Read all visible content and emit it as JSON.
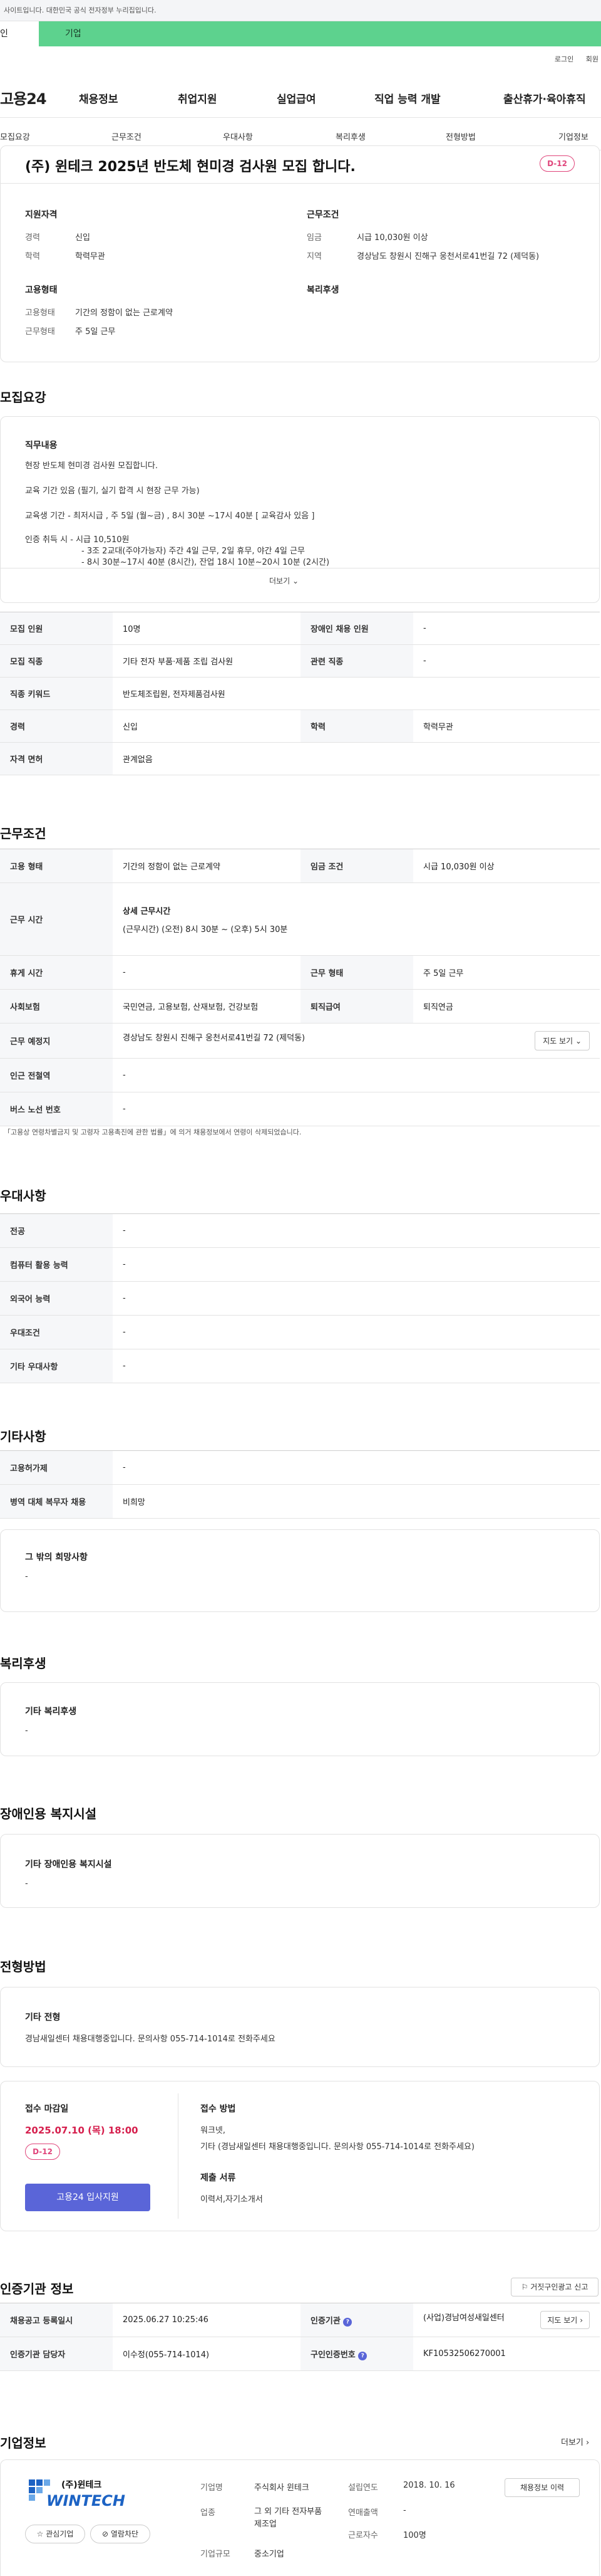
{
  "gov_bar": {
    "text": "사이트입니다. 대한민국 공식 전자정부 누리집입니다."
  },
  "audience_tabs": {
    "individual": "인",
    "business": "기업"
  },
  "util": {
    "login": "로그인",
    "signup": "회원"
  },
  "gnb": {
    "logo": "고용24",
    "menu": [
      "채용정보",
      "취업지원",
      "실업급여",
      "직업 능력 개발",
      "출산휴가·육아휴직"
    ]
  },
  "anchor": [
    "모집요강",
    "근무조건",
    "우대사항",
    "복리후생",
    "전형방법",
    "기업정보"
  ],
  "job": {
    "title": "(주) 윈테크 2025년 반도체 현미경 검사원 모집 합니다.",
    "dday": "D-12",
    "qual_title": "지원자격",
    "cond_title": "근무조건",
    "qual": [
      {
        "label": "경력",
        "value": "신입"
      },
      {
        "label": "학력",
        "value": "학력무관"
      }
    ],
    "cond": [
      {
        "label": "임금",
        "value": "시급 10,030원 이상"
      },
      {
        "label": "지역",
        "value": "경상남도 창원시 진해구 웅천서로41번길 72 (제덕동)"
      }
    ],
    "emp_title": "고용형태",
    "welfare_title": "복리후생",
    "emp": [
      {
        "label": "고용형태",
        "value": "기간의 정함이 없는 근로계약"
      },
      {
        "label": "근무형태",
        "value": "주 5일 근무"
      }
    ]
  },
  "recruit": {
    "section": "모집요강",
    "duty_title": "직무내용",
    "duty_lines": [
      "현장 반도체 현미경 검사원 모집합니다.",
      "교육 기간 있음 (필기, 실기 합격 시 현장 근무 가능)",
      "교육생 기간 - 최저시급 , 주 5일 (월~금) , 8시 30분 ~17시 40분 [ 교육감사 있음 ]",
      "인증 취득 시 - 시급 10,510원",
      "- 3조 2교대(주야가능자)  주간 4일 근무, 2일 휴무, 야간 4일 근무",
      "- 8시 30분~17시 40분 (8시간), 잔업 18시 10분~20시 10분 (2시간)"
    ],
    "more": "더보기",
    "rows": [
      [
        {
          "k": "모집 인원",
          "v": "10명"
        },
        {
          "k": "장애인 채용 인원",
          "v": "-"
        }
      ],
      [
        {
          "k": "모집 직종",
          "v": "기타 전자 부품·제품 조립 검사원"
        },
        {
          "k": "관련 직종",
          "v": "-"
        }
      ],
      [
        {
          "k": "직종 키워드",
          "v": "반도체조립원, 전자제품검사원"
        }
      ],
      [
        {
          "k": "경력",
          "v": "신입"
        },
        {
          "k": "학력",
          "v": "학력무관"
        }
      ],
      [
        {
          "k": "자격 면허",
          "v": "관계없음"
        }
      ]
    ]
  },
  "conditions": {
    "section": "근무조건",
    "emp_type": {
      "k": "고용 형태",
      "v": "기간의 정함이 없는 근로계약"
    },
    "wage": {
      "k": "임금 조건",
      "v": "시급 10,030원 이상"
    },
    "hours": {
      "k": "근무 시간",
      "title": "상세 근무시간",
      "v": "(근무시간) (오전) 8시 30분 ~ (오후) 5시 30분"
    },
    "holiday": {
      "k": "휴게 시간",
      "v": "-"
    },
    "work_form": {
      "k": "근무 형태",
      "v": "주 5일 근무"
    },
    "insurance": {
      "k": "사회보험",
      "v": "국민연금, 고용보험, 산재보험, 건강보험"
    },
    "retire": {
      "k": "퇴직급여",
      "v": "퇴직연금"
    },
    "location": {
      "k": "근무 예정지",
      "v": "경상남도 창원시 진해구 웅천서로41번길 72 (제덕동)",
      "btn": "지도 보기"
    },
    "station": {
      "k": "인근 전철역",
      "v": "-"
    },
    "bus": {
      "k": "버스 노선 번호",
      "v": "-"
    },
    "note": "「고용상 연령차별금지 및 고령자 고용촉진에 관한 법률」에 의거 채용정보에서 연령이 삭제되었습니다."
  },
  "pref": {
    "section": "우대사항",
    "rows": [
      {
        "k": "전공",
        "v": "-"
      },
      {
        "k": "컴퓨터 활용 능력",
        "v": "-"
      },
      {
        "k": "외국어 능력",
        "v": "-"
      },
      {
        "k": "우대조건",
        "v": "-"
      },
      {
        "k": "기타 우대사항",
        "v": "-"
      }
    ]
  },
  "etc": {
    "section": "기타사항",
    "rows": [
      {
        "k": "고용허가제",
        "v": "-"
      },
      {
        "k": "병역 대체 복무자 채용",
        "v": "비희망"
      }
    ],
    "other_title": "그 밖의 희망사항",
    "other_value": "-"
  },
  "welfare": {
    "section": "복리후생",
    "title": "기타 복리후생",
    "value": "-"
  },
  "disability": {
    "section": "장애인용 복지시설",
    "title": "기타 장애인용 복지시설",
    "value": "-"
  },
  "screening": {
    "section": "전형방법",
    "title": "기타 전형",
    "value": "경남새일센터 채용대행중입니다. 문의사항 055-714-1014로 전화주세요",
    "deadline_title": "접수 마감일",
    "deadline": "2025.07.10 (목) 18:00",
    "dday": "D-12",
    "apply_btn": "고용24 입사지원",
    "method_title": "접수 방법",
    "method_lines": [
      "워크넷,",
      "기타 (경남새일센터 채용대행중입니다. 문의사항 055-714-1014로 전화주세요)"
    ],
    "docs_title": "제출 서류",
    "docs": "이력서,자기소개서"
  },
  "agency": {
    "section": "인증기관 정보",
    "report_btn": "거짓구인광고 신고",
    "reg_k": "채용공고 등록일시",
    "reg_v": "2025.06.27 10:25:46",
    "org_k": "인증기관",
    "org_v": "(사업)경남여성새일센터",
    "map_btn": "지도 보기",
    "mgr_k": "인증기관 담당자",
    "mgr_v": "이수정(055-714-1014)",
    "no_k": "구인인증번호",
    "no_v": "KF10532506270001"
  },
  "company": {
    "section": "기업정보",
    "more": "더보기",
    "logo_top": "(주)윈테크",
    "logo_main": "WINTECH",
    "fav": "관심기업",
    "block": "열람차단",
    "name_k": "기업명",
    "name_v": "주식회사 윈테크",
    "ind_k": "업종",
    "ind_v": "그 외 기타 전자부품 제조업",
    "size_k": "기업규모",
    "size_v": "중소기업",
    "est_k": "설립연도",
    "est_v": "2018. 10. 16",
    "sales_k": "연매출액",
    "sales_v": "-",
    "emp_k": "근로자수",
    "emp_v": "100명",
    "jobs_btn": "채용정보 이력"
  },
  "colors": {
    "accent": "#5a65d8",
    "dday": "#e0457b",
    "biz_tab": "#5dd28e",
    "deadline": "#d6204e"
  }
}
